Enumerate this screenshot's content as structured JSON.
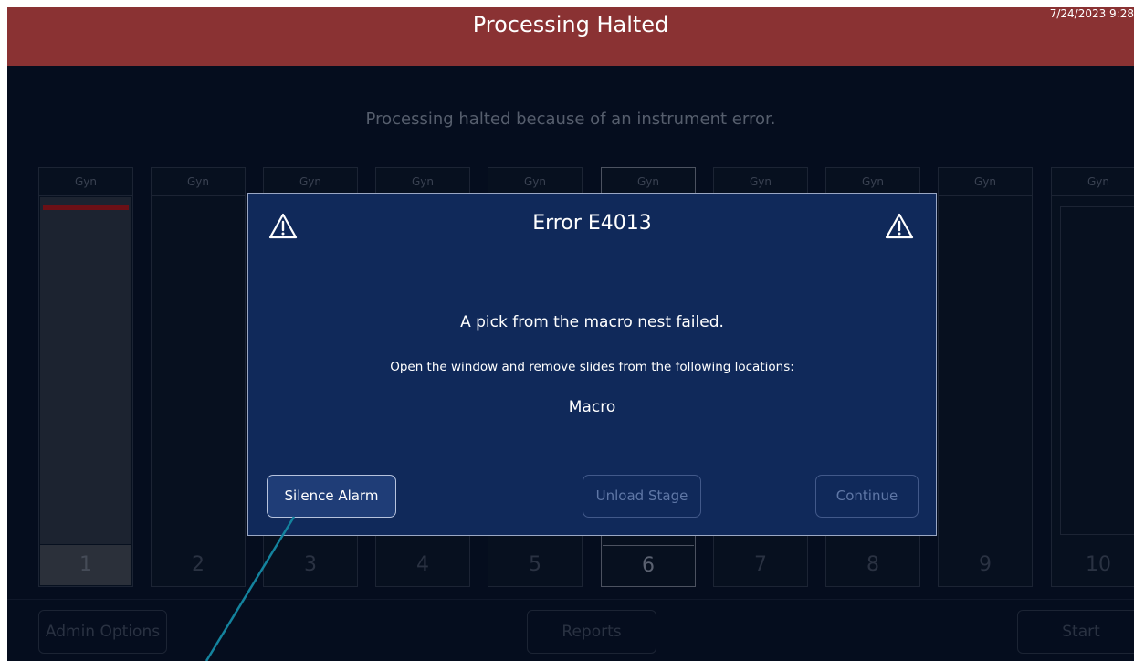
{
  "header": {
    "title": "Processing Halted",
    "timestamp": "7/24/2023 9:28"
  },
  "status_message": "Processing halted because of an instrument error.",
  "columns": [
    {
      "label": "Gyn",
      "number": "1"
    },
    {
      "label": "Gyn",
      "number": "2"
    },
    {
      "label": "Gyn",
      "number": "3"
    },
    {
      "label": "Gyn",
      "number": "4"
    },
    {
      "label": "Gyn",
      "number": "5"
    },
    {
      "label": "Gyn",
      "number": "6"
    },
    {
      "label": "Gyn",
      "number": "7"
    },
    {
      "label": "Gyn",
      "number": "8"
    },
    {
      "label": "Gyn",
      "number": "9"
    },
    {
      "label": "Gyn",
      "number": "10"
    }
  ],
  "footer": {
    "admin_label": "Admin Options",
    "reports_label": "Reports",
    "start_label": "Start"
  },
  "dialog": {
    "title": "Error E4013",
    "headline": "A pick from the macro nest failed.",
    "instructions": "Open the window and remove slides from the following locations:",
    "location": "Macro",
    "buttons": {
      "silence": "Silence Alarm",
      "unload": "Unload Stage",
      "continue": "Continue"
    }
  },
  "colors": {
    "header_bg": "#8a3233",
    "screen_bg": "#050d1e",
    "dialog_bg": "#10295a",
    "pointer": "#14839e",
    "progress_bar": "#6c1016"
  }
}
